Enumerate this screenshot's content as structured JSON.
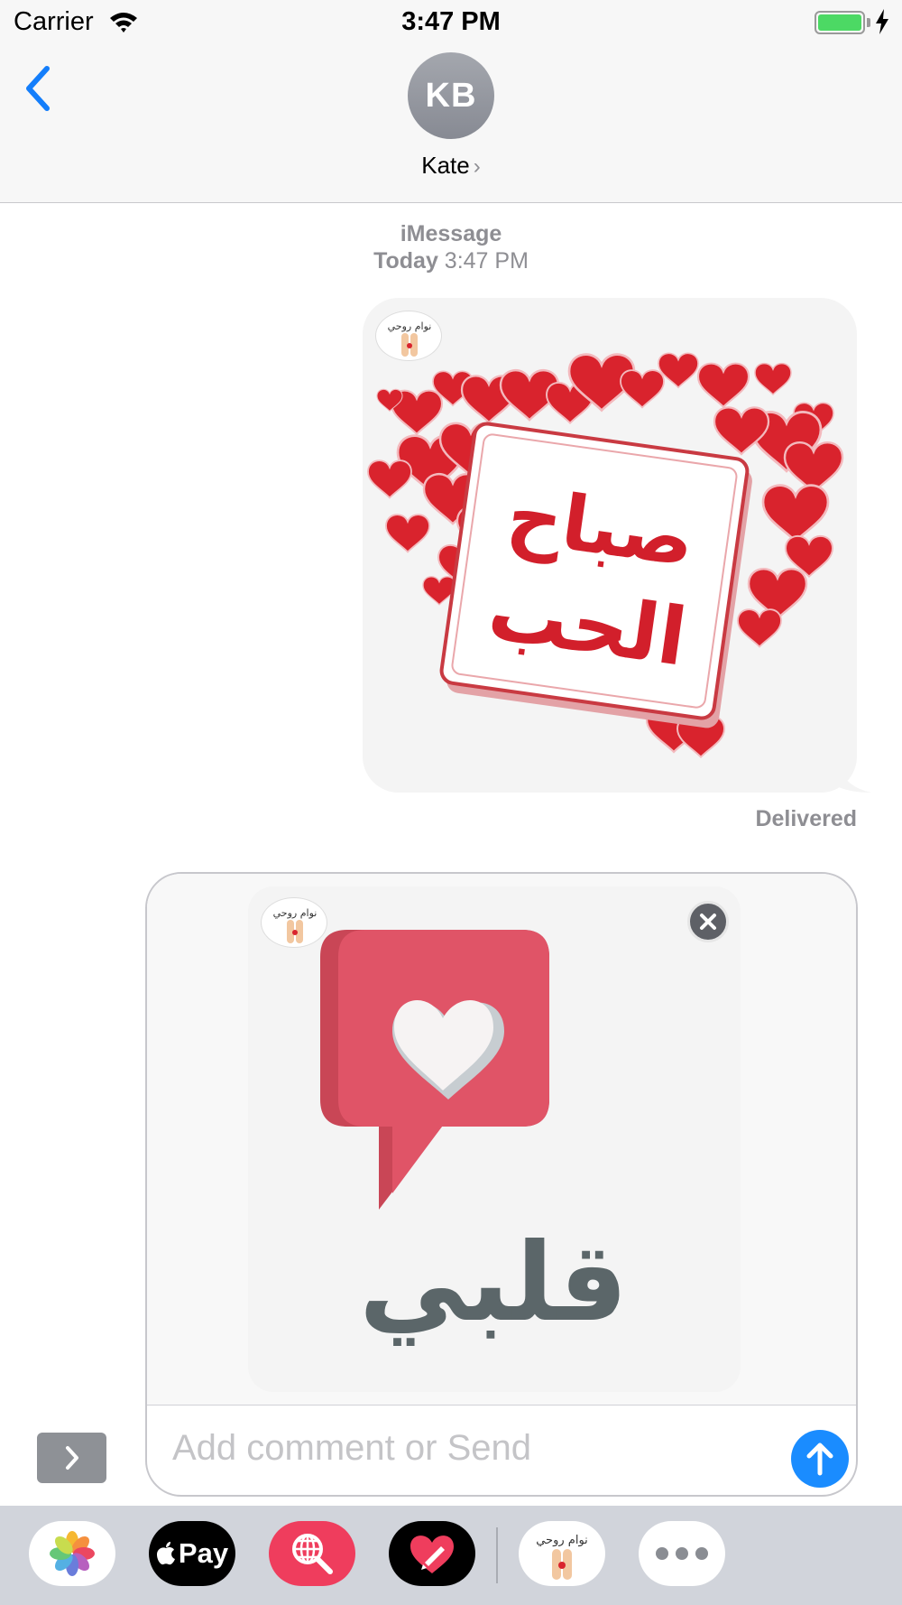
{
  "status_bar": {
    "carrier": "Carrier",
    "time": "3:47 PM"
  },
  "header": {
    "avatar_initials": "KB",
    "contact_name": "Kate"
  },
  "thread": {
    "service": "iMessage",
    "day": "Today",
    "time": "3:47 PM",
    "sent_sticker": {
      "text_line1": "صباح",
      "text_line2": "الحب"
    },
    "status": "Delivered"
  },
  "compose": {
    "sticker_text": "قلبي",
    "placeholder": "Add comment or Send"
  },
  "sticker_pack_badge": "نوام روحي",
  "app_drawer": {
    "apple_pay_label": "Pay",
    "icons": [
      "photos-icon",
      "apple-pay-icon",
      "web-search-icon",
      "digital-touch-icon",
      "sticker-pack-icon",
      "more-icon"
    ]
  },
  "colors": {
    "accent": "#1a8cff",
    "heart_red": "#d9232d",
    "sticker_pink": "#e05467",
    "sticker_grey": "#5b6669"
  }
}
